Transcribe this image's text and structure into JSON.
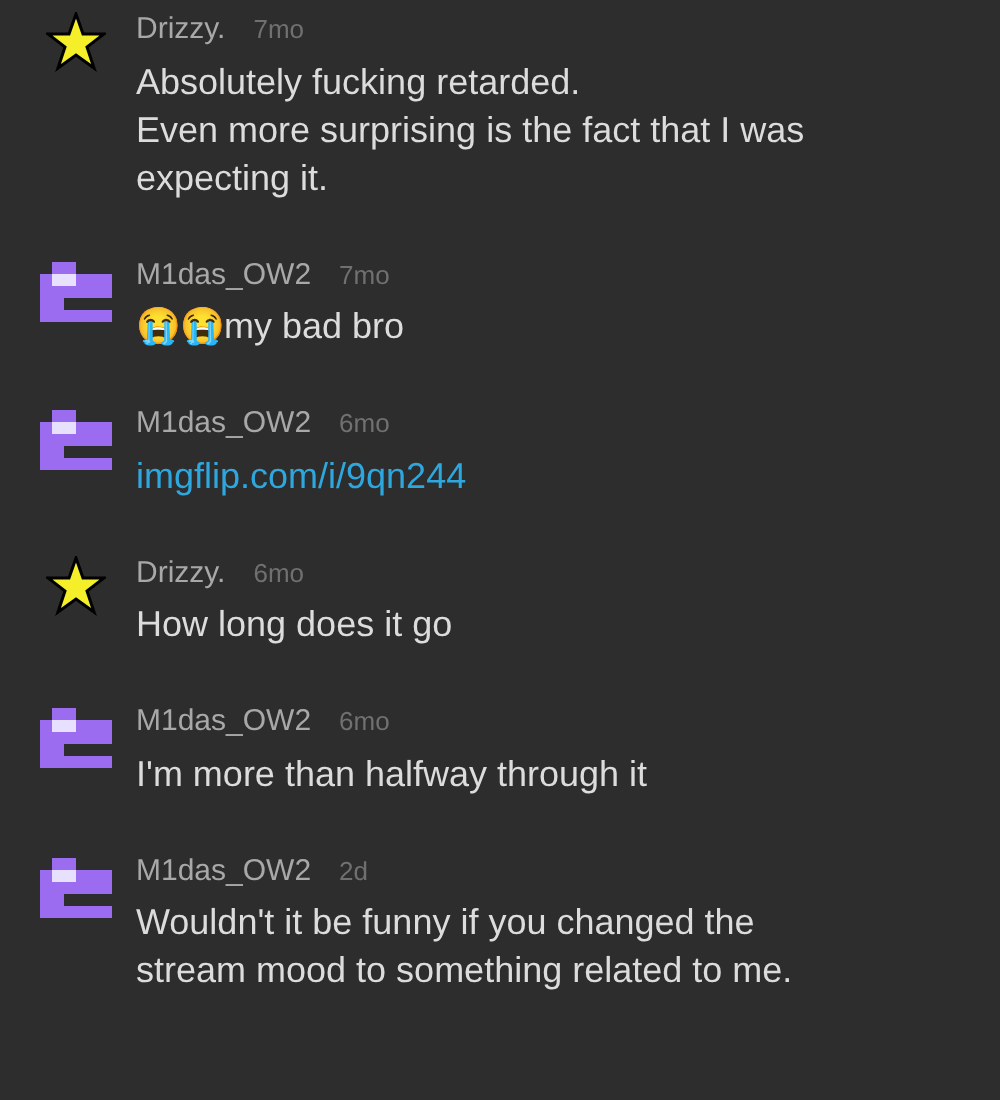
{
  "comments": [
    {
      "avatar": {
        "kind": "star"
      },
      "username": "Drizzy.",
      "time": "7mo",
      "body": [
        {
          "kind": "text",
          "lines": [
            "Absolutely fucking retarded.",
            "Even more surprising is the fact that I was",
            "expecting it."
          ]
        }
      ]
    },
    {
      "avatar": {
        "kind": "pixel"
      },
      "username": "M1das_OW2",
      "time": "7mo",
      "body": [
        {
          "kind": "text",
          "lines": [
            "😭😭my bad bro"
          ]
        }
      ]
    },
    {
      "avatar": {
        "kind": "pixel"
      },
      "username": "M1das_OW2",
      "time": "6mo",
      "body": [
        {
          "kind": "link",
          "lines": [
            "imgflip.com/i/9qn244"
          ]
        }
      ]
    },
    {
      "avatar": {
        "kind": "star"
      },
      "username": "Drizzy.",
      "time": "6mo",
      "body": [
        {
          "kind": "text",
          "lines": [
            "How long does it go"
          ]
        }
      ]
    },
    {
      "avatar": {
        "kind": "pixel"
      },
      "username": "M1das_OW2",
      "time": "6mo",
      "body": [
        {
          "kind": "text",
          "lines": [
            "I'm more than halfway through it"
          ]
        }
      ]
    },
    {
      "avatar": {
        "kind": "pixel"
      },
      "username": "M1das_OW2",
      "time": "2d",
      "body": [
        {
          "kind": "text",
          "lines": [
            "Wouldn't it be funny if you changed the",
            "stream mood to something related to me."
          ]
        }
      ]
    }
  ]
}
